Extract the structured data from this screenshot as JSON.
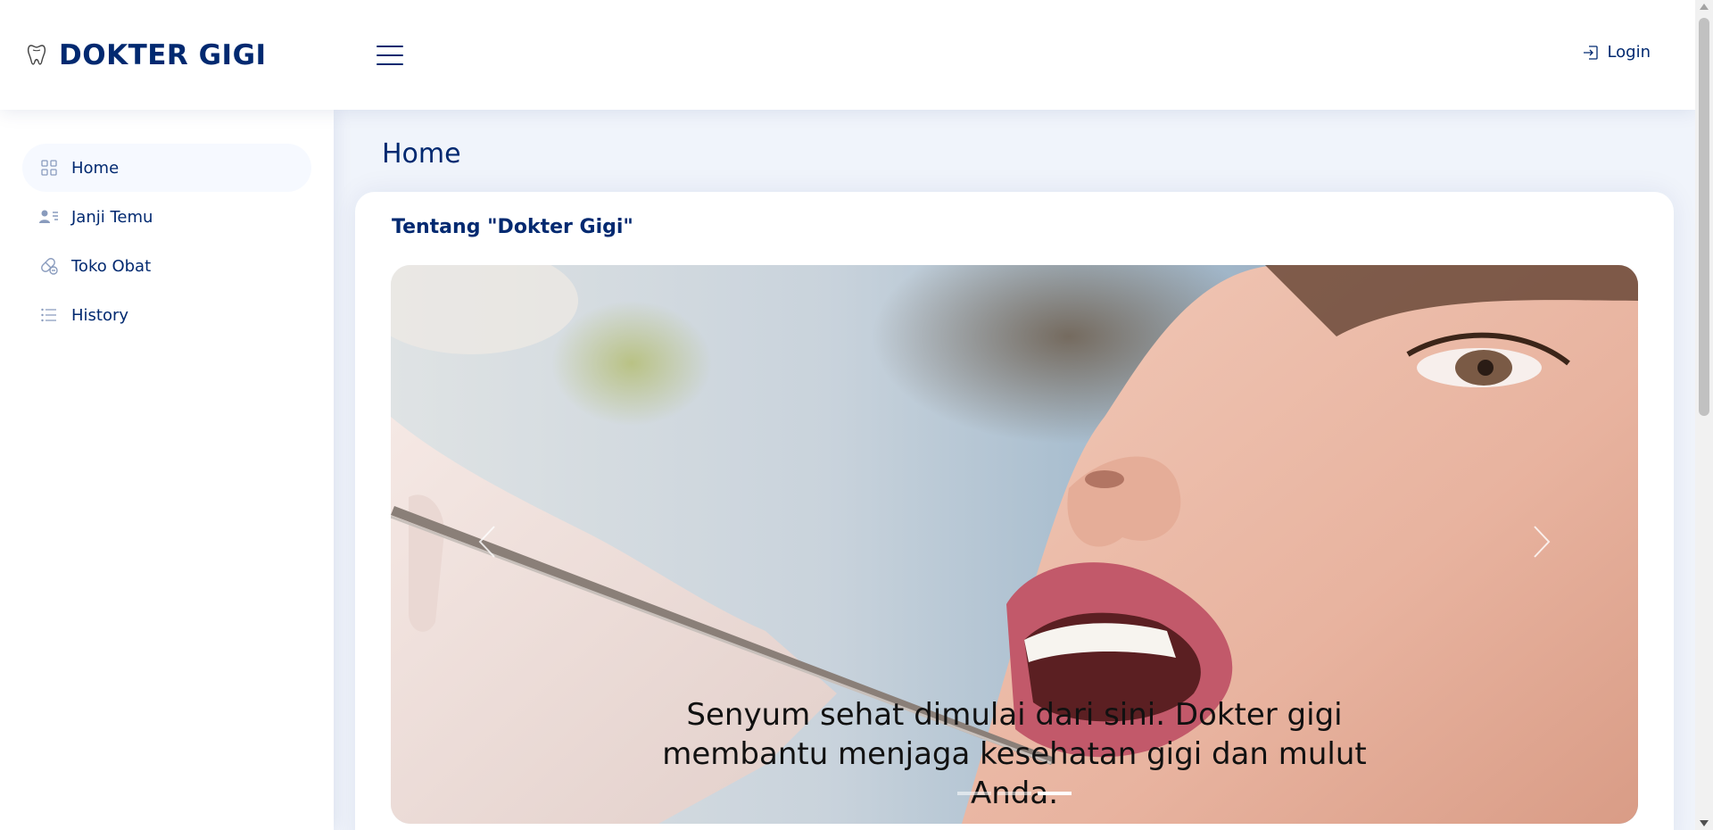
{
  "header": {
    "brand_name": "DOKTER GIGI",
    "brand_icon": "tooth-icon",
    "menu_icon": "hamburger-icon",
    "login_label": "Login",
    "login_icon": "login-icon"
  },
  "sidebar": {
    "items": [
      {
        "label": "Home",
        "icon": "grid-icon",
        "active": true
      },
      {
        "label": "Janji Temu",
        "icon": "person-lines-icon",
        "active": false
      },
      {
        "label": "Toko Obat",
        "icon": "capsule-icon",
        "active": false
      },
      {
        "label": "History",
        "icon": "list-icon",
        "active": false
      }
    ]
  },
  "main": {
    "page_title": "Home",
    "card": {
      "title": "Tentang \"Dokter Gigi\"",
      "carousel": {
        "caption": "Senyum sehat dimulai dari sini. Dokter gigi membantu menjaga kesehatan gigi dan mulut Anda.",
        "slide_count": 3,
        "active_slide": 3,
        "prev_icon": "chevron-left-icon",
        "next_icon": "chevron-right-icon"
      }
    }
  },
  "colors": {
    "brand": "#012970",
    "page_background": "#f0f4fb",
    "active_nav_background": "#f6f9ff"
  }
}
